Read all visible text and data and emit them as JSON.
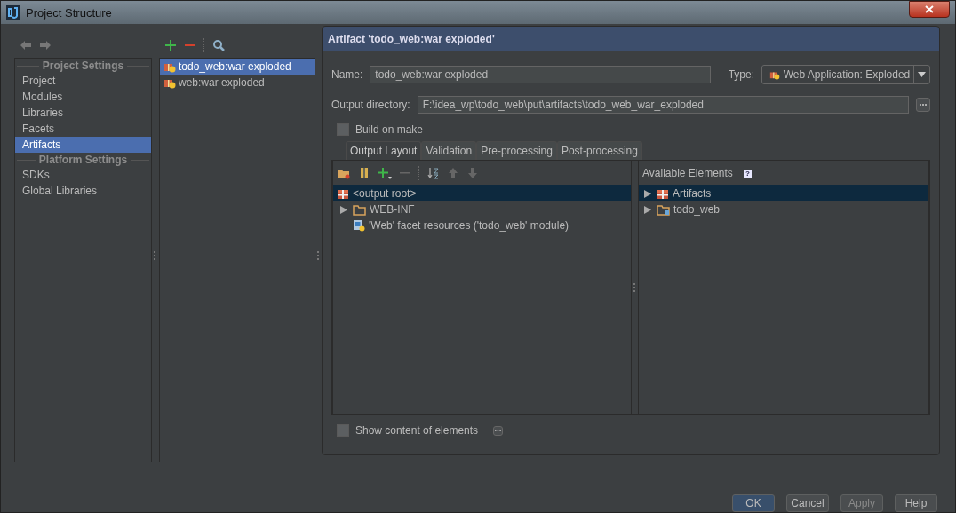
{
  "window": {
    "title": "Project Structure"
  },
  "nav": {
    "sections": [
      {
        "heading": "Project Settings",
        "items": [
          {
            "label": "Project",
            "selected": false
          },
          {
            "label": "Modules",
            "selected": false
          },
          {
            "label": "Libraries",
            "selected": false
          },
          {
            "label": "Facets",
            "selected": false
          },
          {
            "label": "Artifacts",
            "selected": true
          }
        ]
      },
      {
        "heading": "Platform Settings",
        "items": [
          {
            "label": "SDKs",
            "selected": false
          },
          {
            "label": "Global Libraries",
            "selected": false
          }
        ]
      }
    ]
  },
  "artifacts": [
    {
      "label": "todo_web:war exploded",
      "selected": true
    },
    {
      "label": "web:war exploded",
      "selected": false
    }
  ],
  "detail": {
    "header": "Artifact 'todo_web:war exploded'",
    "name": {
      "label": "Name:",
      "value": "todo_web:war exploded"
    },
    "type": {
      "label": "Type:",
      "value": "Web Application: Exploded"
    },
    "output_directory": {
      "label": "Output directory:",
      "value": "F:\\idea_wp\\todo_web\\put\\artifacts\\todo_web_war_exploded"
    },
    "build_on_make": {
      "label": "Build on make",
      "checked": false
    },
    "tabs": [
      {
        "label": "Output Layout",
        "selected": true
      },
      {
        "label": "Validation",
        "selected": false
      },
      {
        "label": "Pre-processing",
        "selected": false
      },
      {
        "label": "Post-processing",
        "selected": false
      }
    ],
    "layout_tree": [
      {
        "label": "<output root>",
        "kind": "artifact",
        "selected": true,
        "children": [
          {
            "label": "WEB-INF",
            "kind": "folder",
            "expanded": false,
            "selected": false
          },
          {
            "label": "'Web' facet resources ('todo_web' module)",
            "kind": "facet",
            "selected": false
          }
        ]
      }
    ],
    "available": {
      "heading": "Available Elements",
      "help": "?",
      "items": [
        {
          "label": "Artifacts",
          "kind": "artifact",
          "expanded": false,
          "selected": true
        },
        {
          "label": "todo_web",
          "kind": "module",
          "expanded": false,
          "selected": false
        }
      ]
    },
    "show_content": {
      "label": "Show content of elements",
      "checked": false
    }
  },
  "buttons": [
    {
      "label": "OK",
      "default": true,
      "disabled": false
    },
    {
      "label": "Cancel",
      "default": false,
      "disabled": false
    },
    {
      "label": "Apply",
      "default": false,
      "disabled": true
    },
    {
      "label": "Help",
      "default": false,
      "disabled": false
    }
  ]
}
